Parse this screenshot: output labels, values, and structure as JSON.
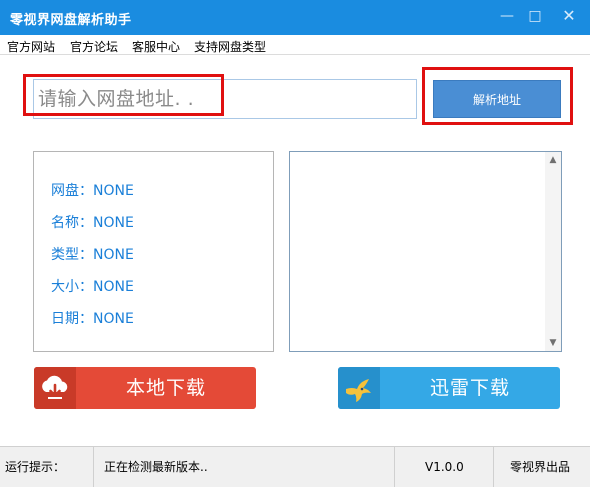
{
  "window": {
    "title": "零视界网盘解析助手",
    "controls": {
      "minimize": "—",
      "maximize": "□",
      "close": "✕"
    }
  },
  "menu": {
    "items": [
      "官方网站",
      "官方论坛",
      "客服中心",
      "支持网盘类型"
    ]
  },
  "search": {
    "placeholder": "请输入网盘地址. .",
    "value": ""
  },
  "parse_button": {
    "label": "解析地址"
  },
  "info": {
    "lines": [
      {
        "label": "网盘",
        "value": "NONE"
      },
      {
        "label": "名称",
        "value": "NONE"
      },
      {
        "label": "类型",
        "value": "NONE"
      },
      {
        "label": "大小",
        "value": "NONE"
      },
      {
        "label": "日期",
        "value": "NONE"
      }
    ],
    "separator": "："
  },
  "output_box": {
    "value": ""
  },
  "downloads": {
    "local": {
      "label": "本地下载",
      "icon": "cloud-download-icon"
    },
    "thunder": {
      "label": "迅雷下载",
      "icon": "hummingbird-icon"
    }
  },
  "status": {
    "label": "运行提示：",
    "message": "正在检测最新版本..",
    "version": "V1.0.0",
    "publisher": "零视界出品"
  },
  "colors": {
    "titlebar": "#1a8ce0",
    "accent_blue": "#4a8ed4",
    "info_text": "#1a7fd8",
    "local_button": "#e44a37",
    "thunder_button": "#34a8e6",
    "highlight_red": "#e01010"
  }
}
